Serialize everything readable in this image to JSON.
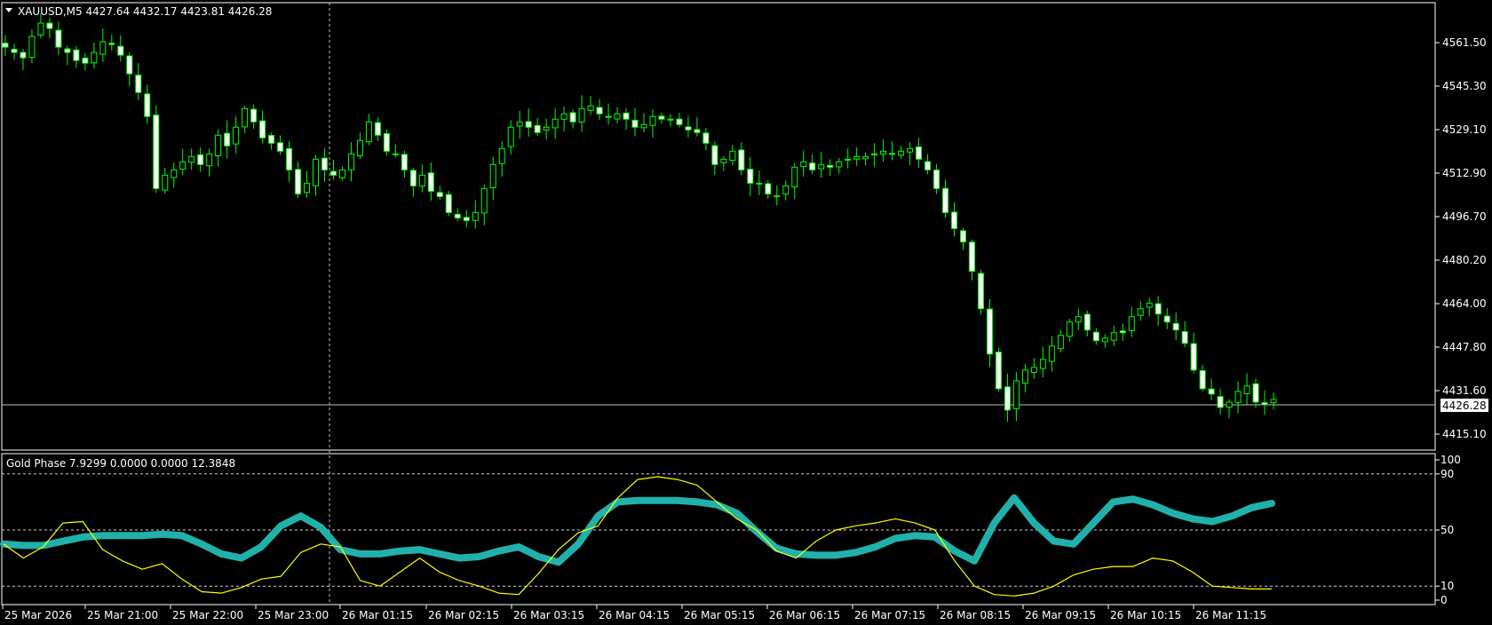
{
  "symbol_header": {
    "dropdown_icon": "triangle-down-icon",
    "text": "XAUUSD,M5  4427.64 4432.17 4423.81 4426.28"
  },
  "indicator_header": {
    "text": "Gold Phase 7.9299 0.0000 0.0000 12.3848"
  },
  "price_axis": {
    "ticks": [
      "4561.50",
      "4545.30",
      "4529.10",
      "4512.90",
      "4496.70",
      "4480.20",
      "4464.00",
      "4447.80",
      "4431.60",
      "4415.10"
    ],
    "current_price": "4426.28"
  },
  "indicator_axis": {
    "ticks": [
      "100",
      "90",
      "50",
      "10",
      "0"
    ],
    "levels": [
      90,
      50,
      10
    ]
  },
  "time_axis": {
    "labels": [
      "25 Mar 2026",
      "25 Mar 21:00",
      "25 Mar 22:00",
      "25 Mar 23:00",
      "26 Mar 01:15",
      "26 Mar 02:15",
      "26 Mar 03:15",
      "26 Mar 04:15",
      "26 Mar 05:15",
      "26 Mar 06:15",
      "26 Mar 07:15",
      "26 Mar 08:15",
      "26 Mar 09:15",
      "26 Mar 10:15",
      "26 Mar 11:15"
    ]
  },
  "colors": {
    "background": "#000000",
    "candle": "#00ff00",
    "candle_up_fill": "#000000",
    "candle_down_fill": "#ffffff",
    "thick_line": "#20b2aa",
    "thin_line": "#ffff00",
    "grid_text": "#ffffff"
  },
  "chart_data": [
    {
      "type": "candlestick",
      "title": "XAUUSD,M5",
      "ylim": [
        4408,
        4573
      ],
      "close_path": [
        4558,
        4556,
        4554,
        4562,
        4567,
        4565,
        4558,
        4556,
        4553,
        4552,
        4556,
        4560,
        4559,
        4555,
        4548,
        4541,
        4532,
        4505,
        4510,
        4512,
        4515,
        4517,
        4514,
        4518,
        4525,
        4521,
        4528,
        4535,
        4530,
        4524,
        4522,
        4519,
        4512,
        4503,
        4507,
        4516,
        4512,
        4510,
        4512,
        4518,
        4523,
        4530,
        4525,
        4519,
        4518,
        4512,
        4506,
        4510,
        4504,
        4502,
        4496,
        4494,
        4493,
        4496,
        4505,
        4514,
        4520,
        4528,
        4530,
        4528,
        4526,
        4528,
        4531,
        4533,
        4530,
        4535,
        4536,
        4533,
        4532,
        4533,
        4531,
        4528,
        4529,
        4532,
        4531,
        4531,
        4529,
        4527,
        4526,
        4522,
        4514,
        4516,
        4519,
        4512,
        4507,
        4507,
        4503,
        4502,
        4506,
        4513,
        4515,
        4512,
        4514,
        4513,
        4515,
        4516,
        4517,
        4517,
        4518,
        4519,
        4518,
        4519,
        4520,
        4516,
        4512,
        4505,
        4496,
        4490,
        4485,
        4474,
        4460,
        4443,
        4430,
        4422,
        4433,
        4437,
        4438,
        4441,
        4446,
        4450,
        4455,
        4457,
        4452,
        4448,
        4449,
        4451,
        4451,
        4457,
        4460,
        4462,
        4458,
        4455,
        4452,
        4447,
        4437,
        4430,
        4428,
        4423,
        4425,
        4429,
        4431,
        4425,
        4424,
        4426
      ]
    },
    {
      "type": "line",
      "title": "Gold Phase",
      "ylim": [
        0,
        100
      ],
      "series": [
        {
          "values": [
            40,
            39,
            39,
            42,
            45,
            46,
            46,
            46,
            47,
            46,
            40,
            33,
            30,
            38,
            53,
            60,
            52,
            36,
            33,
            33,
            35,
            36,
            33,
            30,
            31,
            35,
            38,
            31,
            27,
            40,
            60,
            70,
            71,
            71,
            71,
            70,
            68,
            62,
            49,
            37,
            33,
            32,
            32,
            34,
            38,
            44,
            46,
            45,
            35,
            28,
            55,
            73,
            55,
            42,
            40,
            55,
            70,
            72,
            68,
            62,
            58,
            56,
            60,
            66,
            69
          ]
        },
        {
          "values": [
            40,
            30,
            38,
            55,
            56,
            36,
            28,
            22,
            26,
            15,
            6,
            5,
            9,
            15,
            17,
            34,
            40,
            38,
            14,
            10,
            20,
            30,
            20,
            14,
            10,
            5,
            4,
            19,
            36,
            48,
            53,
            73,
            86,
            88,
            86,
            82,
            70,
            58,
            50,
            35,
            30,
            42,
            50,
            53,
            55,
            58,
            55,
            50,
            28,
            10,
            4,
            3,
            5,
            10,
            18,
            22,
            24,
            24,
            30,
            28,
            20,
            10,
            9,
            8,
            8
          ]
        }
      ]
    }
  ]
}
